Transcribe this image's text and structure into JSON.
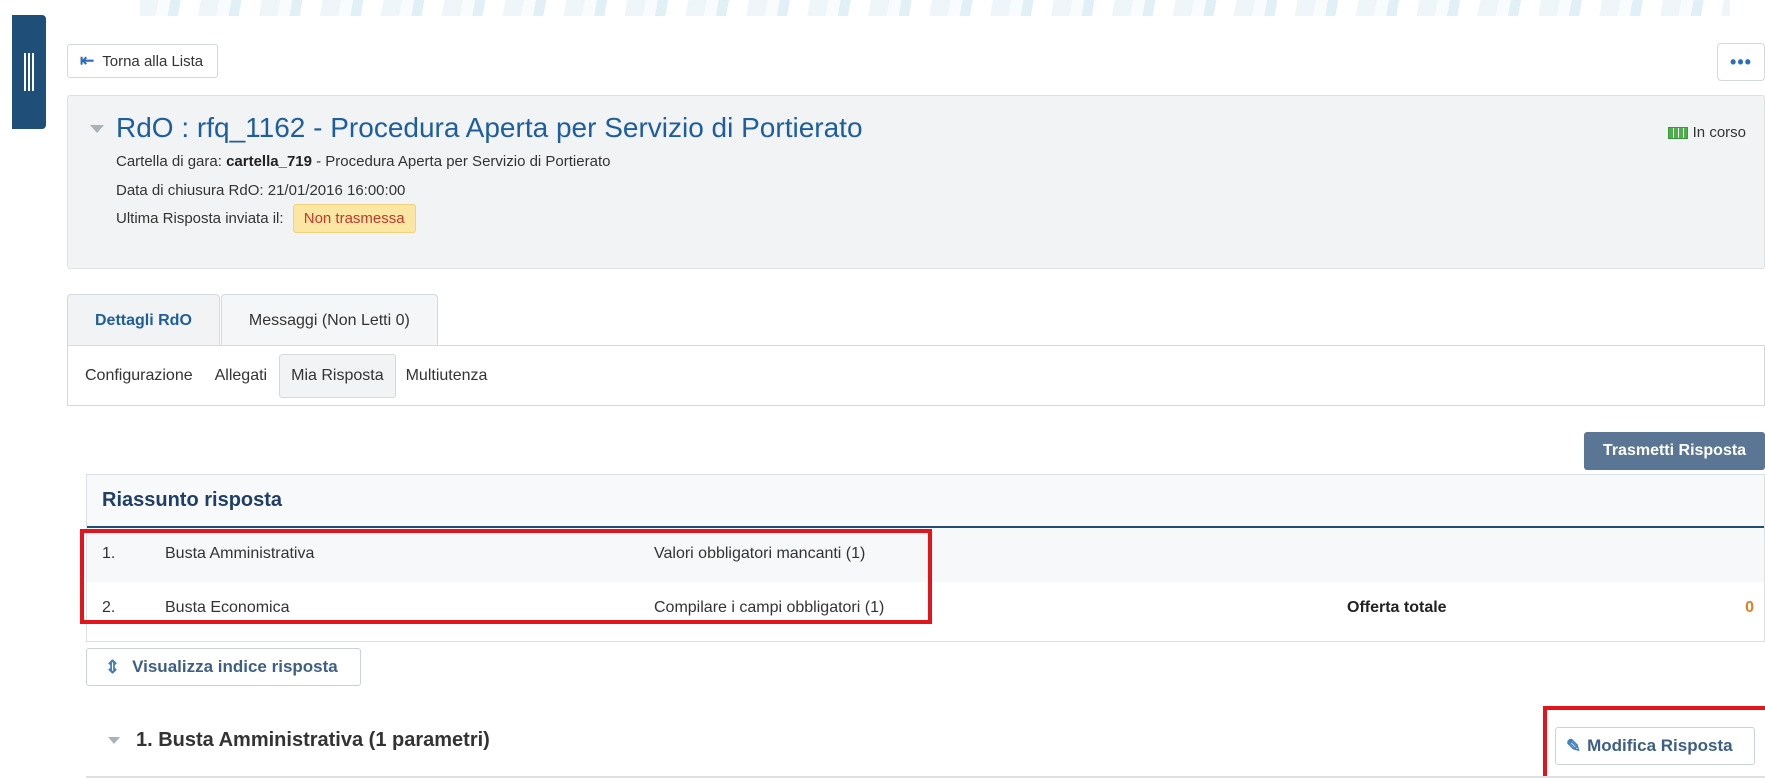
{
  "nav": {
    "back_label": "Torna alla Lista",
    "more_label": "•••"
  },
  "header": {
    "title": "RdO : rfq_1162 - Procedura Aperta per Servizio di Portierato",
    "status": "In corso",
    "folder_label": "Cartella di gara:",
    "folder_value": "cartella_719",
    "folder_desc": " - Procedura Aperta per Servizio di Portierato",
    "closing_label": "Data di chiusura RdO:",
    "closing_value": "21/01/2016 16:00:00",
    "last_response_label": "Ultima Risposta inviata il:",
    "last_response_value": "Non trasmessa"
  },
  "tabs": [
    {
      "label": "Dettagli RdO",
      "active": true
    },
    {
      "label": "Messaggi (Non Letti 0)",
      "active": false
    }
  ],
  "subnav": [
    {
      "label": "Configurazione"
    },
    {
      "label": "Allegati"
    },
    {
      "label": "Mia Risposta",
      "selected": true
    },
    {
      "label": "Multiutenza"
    }
  ],
  "actions": {
    "transmit_label": "Trasmetti Risposta",
    "index_label": "Visualizza indice risposta",
    "edit_label": "Modifica Risposta"
  },
  "summary": {
    "title": "Riassunto risposta",
    "rows": [
      {
        "num": "1.",
        "name": "Busta Amministrativa",
        "status": "Valori obbligatori mancanti (1)",
        "label": "",
        "value": ""
      },
      {
        "num": "2.",
        "name": "Busta Economica",
        "status": "Compilare i campi obbligatori (1)",
        "label": "Offerta totale",
        "value": "0"
      }
    ]
  },
  "section": {
    "title": "1. Busta Amministrativa (1 parametri)"
  },
  "colors": {
    "primary": "#1f5e9c",
    "accent_red": "#e3141b",
    "transmit_bg": "#5b7694",
    "warning_bg": "#fbe6a3"
  }
}
